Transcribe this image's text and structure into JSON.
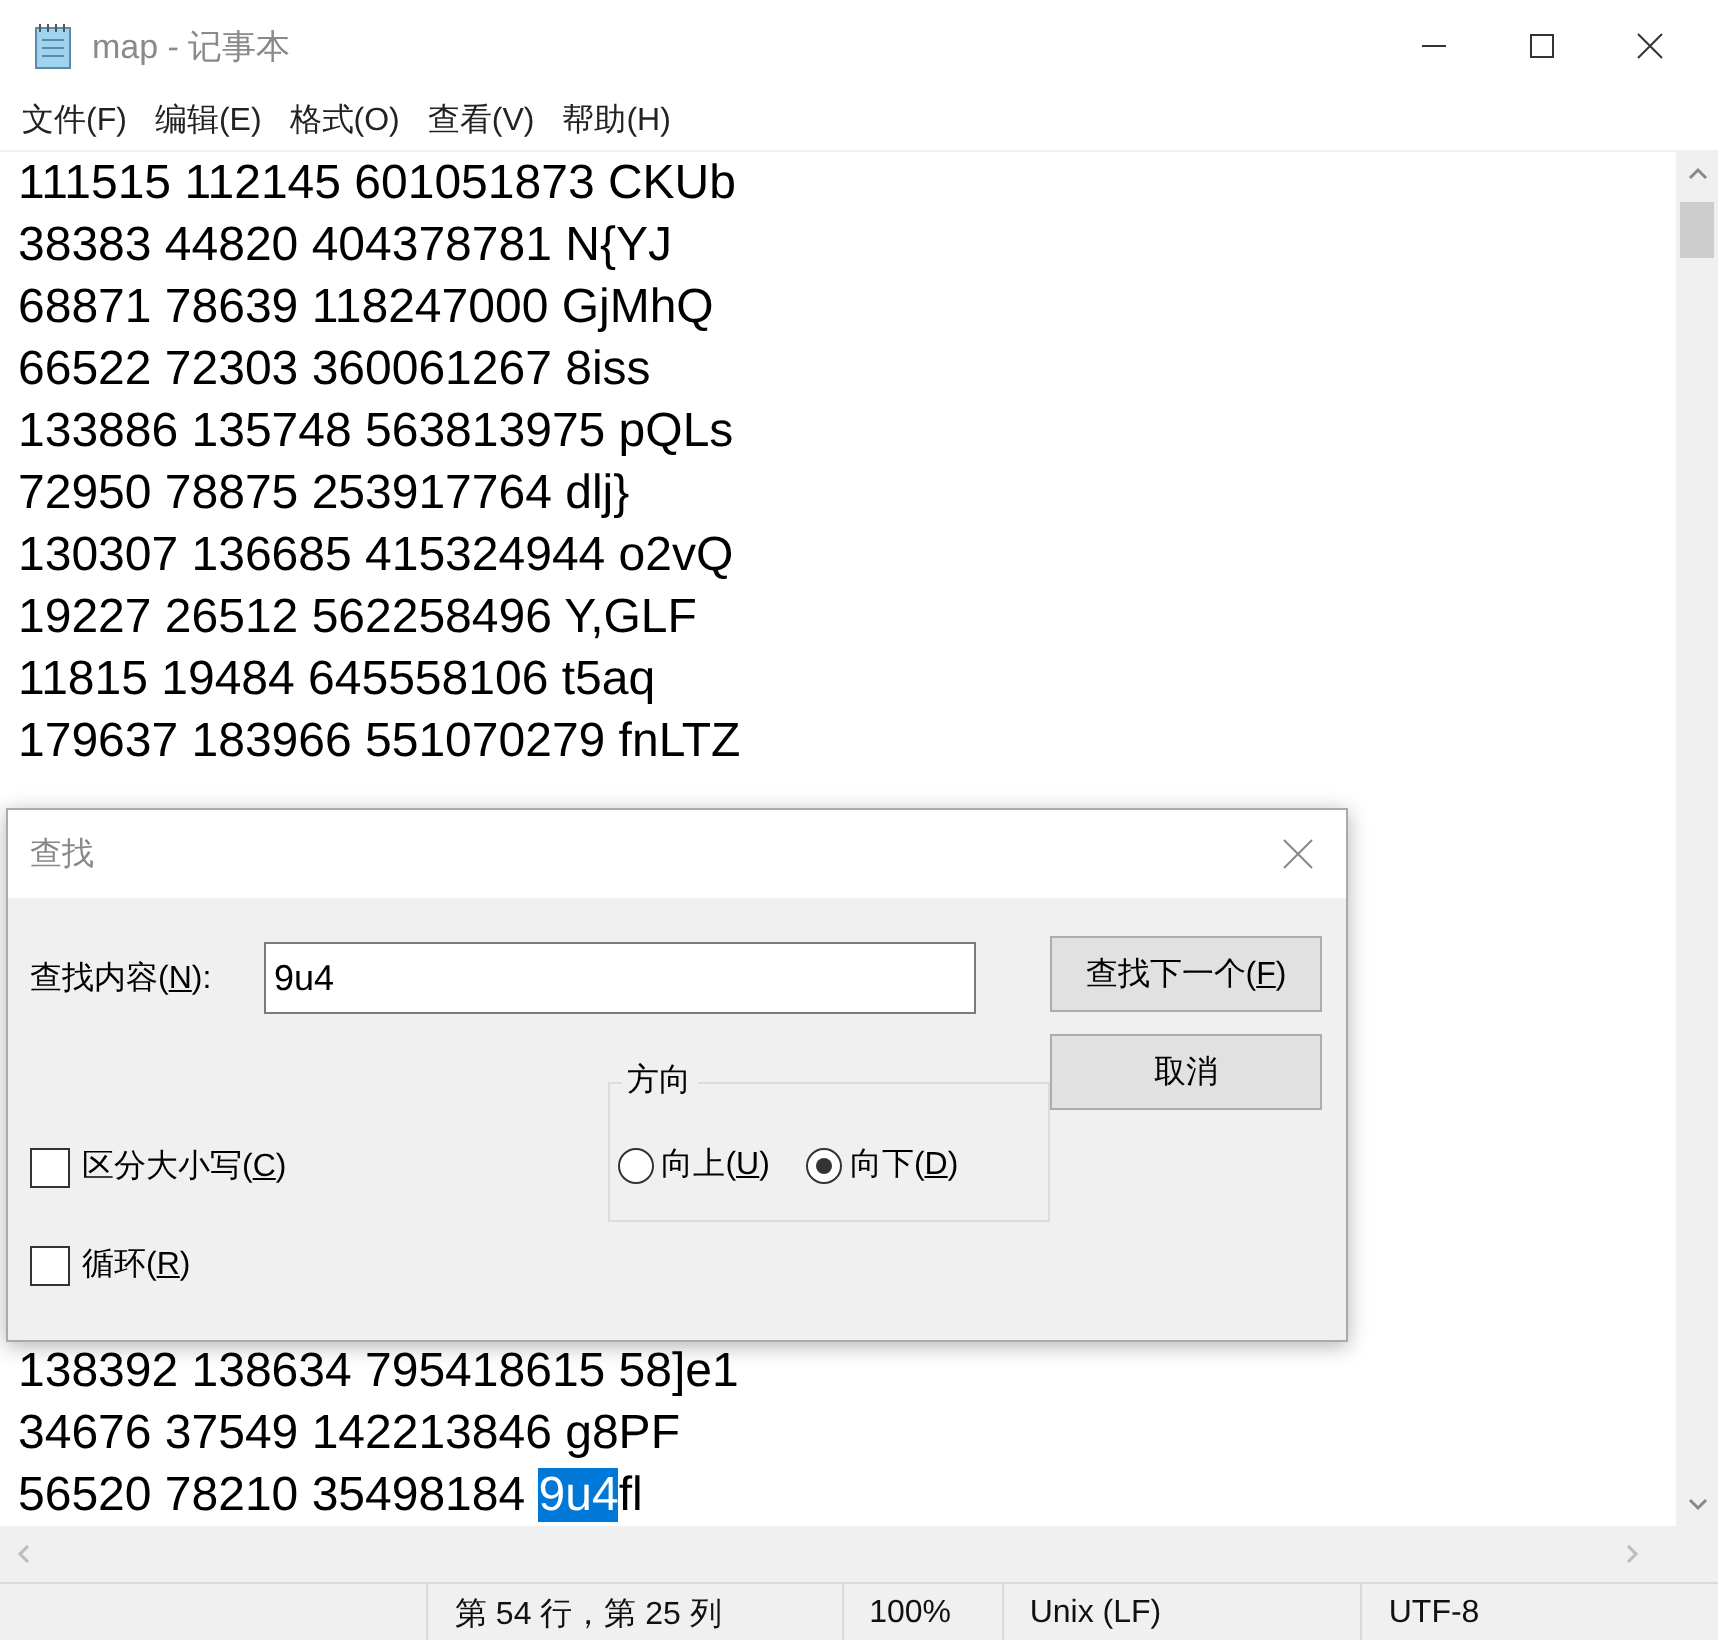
{
  "window": {
    "title": "map - 记事本"
  },
  "menu": [
    {
      "label": "文件(F)"
    },
    {
      "label": "编辑(E)"
    },
    {
      "label": "格式(O)"
    },
    {
      "label": "查看(V)"
    },
    {
      "label": "帮助(H)"
    }
  ],
  "editor": {
    "lines_top": [
      {
        "segments": [
          {
            "text": "111515 112145 601051873 CKUb",
            "selected": false
          }
        ]
      },
      {
        "segments": [
          {
            "text": "38383 44820 404378781 N{YJ",
            "selected": false
          }
        ]
      },
      {
        "segments": [
          {
            "text": "68871 78639 118247000 GjMhQ",
            "selected": false
          }
        ]
      },
      {
        "segments": [
          {
            "text": "66522 72303 360061267 8iss",
            "selected": false
          }
        ]
      },
      {
        "segments": [
          {
            "text": "133886 135748 563813975 pQLs",
            "selected": false
          }
        ]
      },
      {
        "segments": [
          {
            "text": "72950 78875 253917764 dlj}",
            "selected": false
          }
        ]
      },
      {
        "segments": [
          {
            "text": "130307 136685 415324944 o2vQ",
            "selected": false
          }
        ]
      },
      {
        "segments": [
          {
            "text": "19227 26512 562258496 Y,GLF",
            "selected": false
          }
        ]
      },
      {
        "segments": [
          {
            "text": "11815 19484 645558106 t5aq",
            "selected": false
          }
        ]
      },
      {
        "segments": [
          {
            "text": "179637 183966 551070279 fnLTZ",
            "selected": false
          }
        ]
      }
    ],
    "lines_bottom": [
      {
        "segments": [
          {
            "text": "138392 138634 795418615 58]e1",
            "selected": false
          }
        ]
      },
      {
        "segments": [
          {
            "text": "34676 37549 142213846 g8PF",
            "selected": false
          }
        ]
      },
      {
        "segments": [
          {
            "text": "56520 78210 35498184 ",
            "selected": false
          },
          {
            "text": "9u4",
            "selected": true
          },
          {
            "text": "fl",
            "selected": false
          }
        ]
      }
    ]
  },
  "status_bar": [
    {
      "text": "第 54 行，第 25 列"
    },
    {
      "text": "100%"
    },
    {
      "text": "Unix (LF)"
    },
    {
      "text": "UTF-8"
    }
  ],
  "find_dialog": {
    "title": "查找",
    "find_label": {
      "before": "查找内容(",
      "key": "N",
      "after": "):"
    },
    "find_value": "9u4",
    "buttons": [
      {
        "before": "查找下一个(",
        "key": "F",
        "after": ")"
      },
      {
        "before": "取消"
      }
    ],
    "direction": {
      "legend": "方向",
      "options": [
        {
          "before": "向上(",
          "key": "U",
          "after": ")",
          "selected": false
        },
        {
          "before": "向下(",
          "key": "D",
          "after": ")",
          "selected": true
        }
      ]
    },
    "checkboxes": [
      {
        "before": "区分大小写(",
        "key": "C",
        "after": ")",
        "checked": false
      },
      {
        "before": "循环(",
        "key": "R",
        "after": ")",
        "checked": false
      }
    ]
  }
}
